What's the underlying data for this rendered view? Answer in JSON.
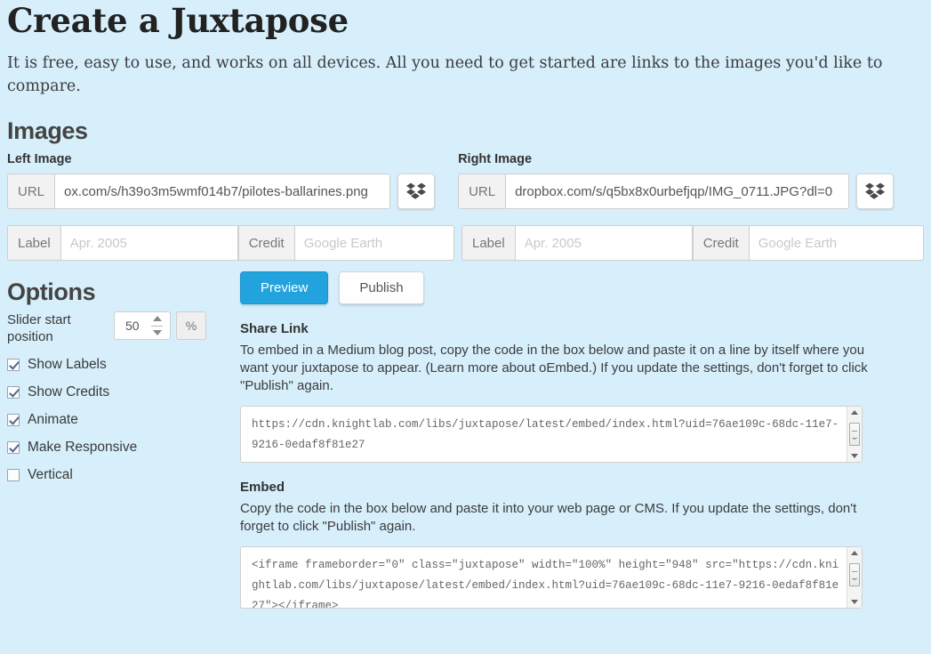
{
  "header": {
    "title": "Create a Juxtapose",
    "intro": "It is free, easy to use, and works on all devices. All you need to get started are links to the images you'd like to compare."
  },
  "images": {
    "heading": "Images",
    "left": {
      "label": "Left Image",
      "url_addon": "URL",
      "url_value": "ox.com/s/h39o3m5wmf014b7/pilotes-ballarines.png",
      "dropbox_icon": "dropbox-icon",
      "label_addon": "Label",
      "label_placeholder": "Apr. 2005",
      "label_value": "",
      "credit_addon": "Credit",
      "credit_placeholder": "Google Earth",
      "credit_value": ""
    },
    "right": {
      "label": "Right Image",
      "url_addon": "URL",
      "url_value": "dropbox.com/s/q5bx8x0urbefjqp/IMG_0711.JPG?dl=0",
      "dropbox_icon": "dropbox-icon",
      "label_addon": "Label",
      "label_placeholder": "Apr. 2005",
      "label_value": "",
      "credit_addon": "Credit",
      "credit_placeholder": "Google Earth",
      "credit_value": ""
    }
  },
  "options": {
    "heading": "Options",
    "slider_start_label": "Slider start position",
    "slider_start_value": "50",
    "slider_start_unit": "%",
    "checkboxes": [
      {
        "label": "Show Labels",
        "checked": true
      },
      {
        "label": "Show Credits",
        "checked": true
      },
      {
        "label": "Animate",
        "checked": true
      },
      {
        "label": "Make Responsive",
        "checked": true
      },
      {
        "label": "Vertical",
        "checked": false
      }
    ]
  },
  "actions": {
    "preview_label": "Preview",
    "publish_label": "Publish"
  },
  "share": {
    "title": "Share Link",
    "description": "To embed in a Medium blog post, copy the code in the box below and paste it on a line by itself where you want your juxtapose to appear. (Learn more about oEmbed.) If you update the settings, don't forget to click \"Publish\" again.",
    "value": "https://cdn.knightlab.com/libs/juxtapose/latest/embed/index.html?uid=76ae109c-68dc-11e7-9216-0edaf8f81e27"
  },
  "embed": {
    "title": "Embed",
    "description": "Copy the code in the box below and paste it into your web page or CMS. If you update the settings, don't forget to click \"Publish\" again.",
    "value": "<iframe frameborder=\"0\" class=\"juxtapose\" width=\"100%\" height=\"948\" src=\"https://cdn.knightlab.com/libs/juxtapose/latest/embed/index.html?uid=76ae109c-68dc-11e7-9216-0edaf8f81e27\"></iframe>"
  },
  "colors": {
    "background": "#d6effb",
    "primary_button": "#23a3dd",
    "text": "#3a3a3a"
  }
}
